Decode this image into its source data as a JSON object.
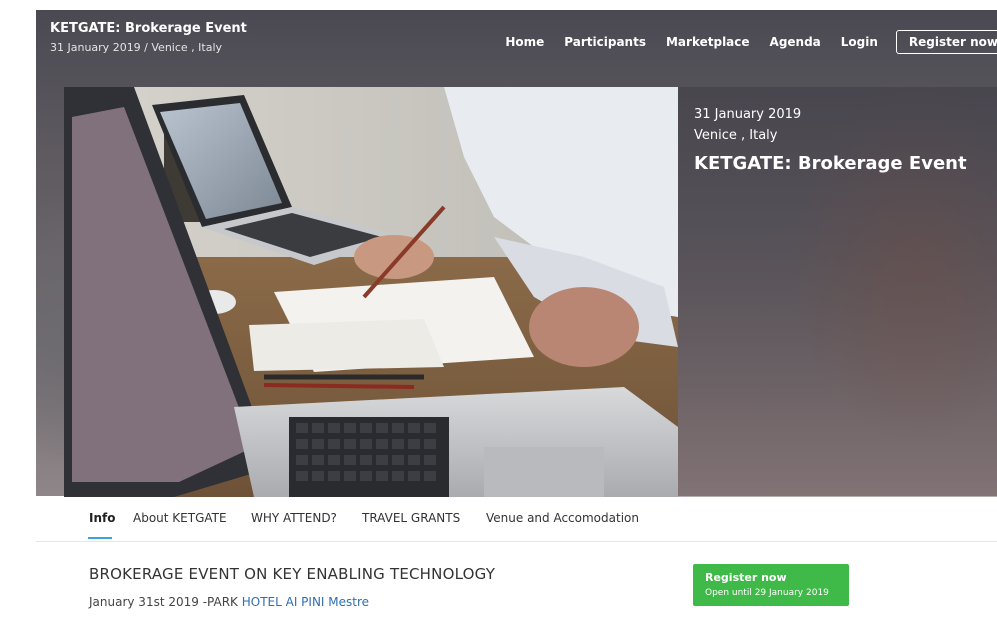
{
  "header": {
    "title": "KETGATE: Brokerage Event",
    "subtitle": "31 January 2019 / Venice , Italy",
    "nav": [
      "Home",
      "Participants",
      "Marketplace",
      "Agenda",
      "Login"
    ],
    "register_label": "Register now"
  },
  "hero": {
    "date": "31 January 2019",
    "location": "Venice , Italy",
    "title": "KETGATE: Brokerage Event"
  },
  "tabs": [
    "Info",
    "About KETGATE",
    "WHY ATTEND?",
    "TRAVEL GRANTS",
    "Venue and Accomodation"
  ],
  "content": {
    "heading": "BROKERAGE EVENT ON KEY ENABLING TECHNOLOGY",
    "date_text": "January 31st 2019 -PARK ",
    "venue_link": "HOTEL AI PINI Mestre"
  },
  "cta": {
    "label": "Register now",
    "sub": "Open until 29 January 2019",
    "color": "#3fb948"
  },
  "colors": {
    "tab_active_underline": "#3aa3dd",
    "link": "#2f6fb0"
  }
}
